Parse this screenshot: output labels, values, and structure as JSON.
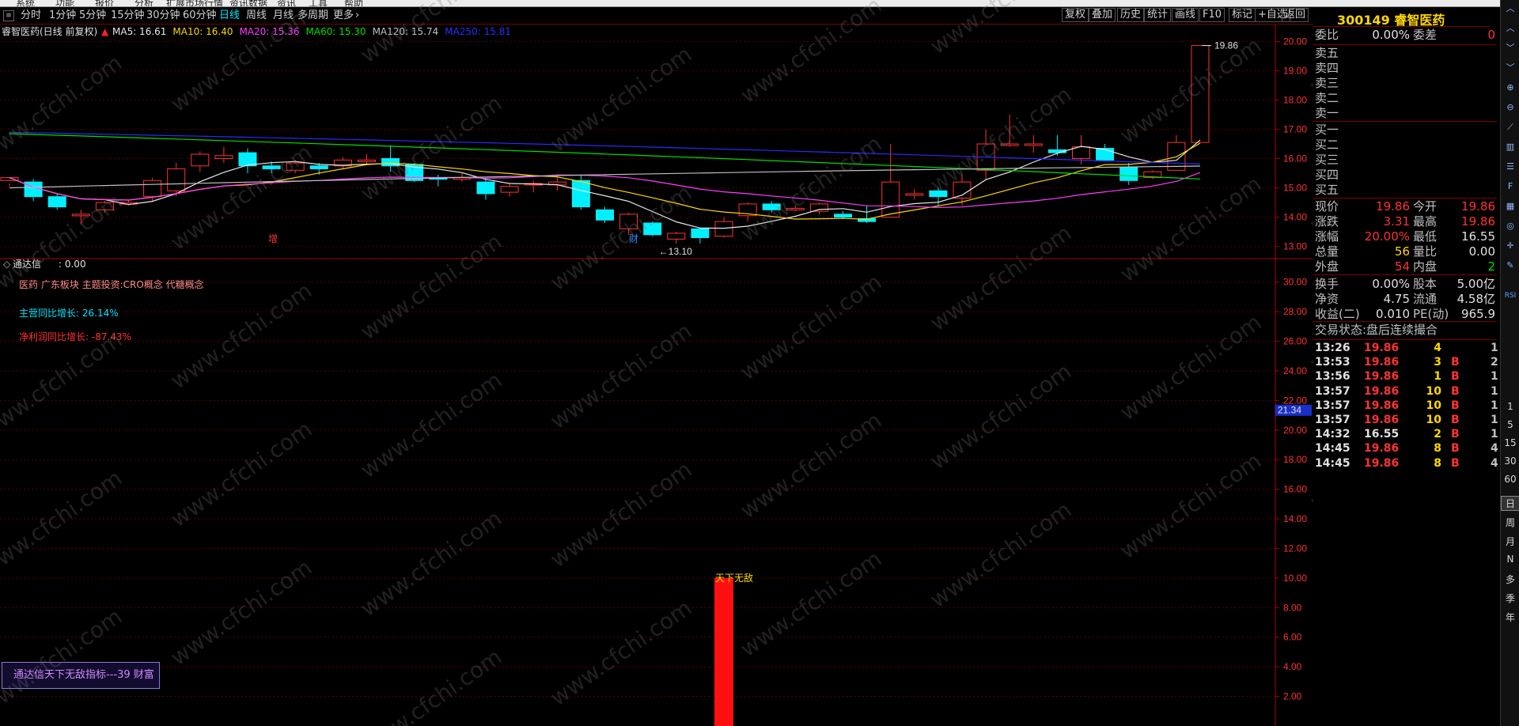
{
  "menubar": {
    "items": [
      "系统",
      "功能",
      "报价",
      "分析",
      "扩展市场行情",
      "资讯数据",
      "资讯",
      "工具",
      "帮助"
    ]
  },
  "period_bar": {
    "tabs": [
      "分时",
      "1分钟",
      "5分钟",
      "15分钟",
      "30分钟",
      "60分钟",
      "日线",
      "周线",
      "月线",
      "多周期",
      "更多"
    ],
    "active": "日线",
    "tools": [
      "复权",
      "叠加",
      "历史",
      "统计",
      "画线",
      "F10",
      "标记",
      "+自选",
      "返回"
    ]
  },
  "stock": {
    "code": "300149",
    "name": "睿智医药",
    "title": "300149 睿智医药"
  },
  "chart_header": {
    "name": "睿智医药(日线 前复权)",
    "ma": [
      {
        "label": "MA5: 16.61",
        "color": "#e8e8e8"
      },
      {
        "label": "MA10: 16.40",
        "color": "#ffd700"
      },
      {
        "label": "MA20: 15.36",
        "color": "#ff3cff"
      },
      {
        "label": "MA60: 15.30",
        "color": "#00e000"
      },
      {
        "label": "MA120: 15.74",
        "color": "#c0c0c0"
      },
      {
        "label": "MA250: 15.81",
        "color": "#2a2aff"
      }
    ]
  },
  "chart_data": [
    {
      "type": "candlestick",
      "title": "睿智医药(日线 前复权)",
      "ylim": [
        12.8,
        20.2
      ],
      "y_ticks": [
        "20.00",
        "19.00",
        "18.00",
        "17.00",
        "16.00",
        "15.00",
        "14.00",
        "13.00"
      ],
      "annotations": {
        "high": "19.86",
        "low": "13.10",
        "marks": [
          "增",
          "财"
        ]
      },
      "candles": [
        [
          15.25,
          15.35,
          15.15,
          15.05
        ],
        [
          15.2,
          14.7,
          15.3,
          14.55
        ],
        [
          14.7,
          14.35,
          14.8,
          14.25
        ],
        [
          14.1,
          14.1,
          14.25,
          13.75
        ],
        [
          14.25,
          14.5,
          14.55,
          14.15
        ],
        [
          14.5,
          14.5,
          14.6,
          14.4
        ],
        [
          14.7,
          15.25,
          15.35,
          14.55
        ],
        [
          14.9,
          15.65,
          15.85,
          14.7
        ],
        [
          15.75,
          16.15,
          16.25,
          15.55
        ],
        [
          16.0,
          16.1,
          16.4,
          15.85
        ],
        [
          16.2,
          15.75,
          16.35,
          15.5
        ],
        [
          15.75,
          15.65,
          15.9,
          15.5
        ],
        [
          15.6,
          15.85,
          15.95,
          15.5
        ],
        [
          15.75,
          15.65,
          15.85,
          15.45
        ],
        [
          15.75,
          15.95,
          16.05,
          15.65
        ],
        [
          15.95,
          15.95,
          16.15,
          15.8
        ],
        [
          16.0,
          15.75,
          16.45,
          15.55
        ],
        [
          15.8,
          15.25,
          15.85,
          15.2
        ],
        [
          15.35,
          15.3,
          15.45,
          15.05
        ],
        [
          15.35,
          15.35,
          15.5,
          15.2
        ],
        [
          15.2,
          14.8,
          15.3,
          14.6
        ],
        [
          14.85,
          15.05,
          15.15,
          14.7
        ],
        [
          15.15,
          15.15,
          15.25,
          14.85
        ],
        [
          15.1,
          15.2,
          15.45,
          14.9
        ],
        [
          15.25,
          14.35,
          15.45,
          14.25
        ],
        [
          14.25,
          13.9,
          14.35,
          13.8
        ],
        [
          13.6,
          14.1,
          14.15,
          13.4
        ],
        [
          13.8,
          13.4,
          13.85,
          13.35
        ],
        [
          13.25,
          13.45,
          13.5,
          13.1
        ],
        [
          13.6,
          13.3,
          13.65,
          13.1
        ],
        [
          13.35,
          13.85,
          14.0,
          13.3
        ],
        [
          14.05,
          14.45,
          14.5,
          13.85
        ],
        [
          14.45,
          14.25,
          14.55,
          14.15
        ],
        [
          14.3,
          14.3,
          14.4,
          14.2
        ],
        [
          14.2,
          14.45,
          14.5,
          14.1
        ],
        [
          14.1,
          14.0,
          14.2,
          13.95
        ],
        [
          13.95,
          13.85,
          14.4,
          13.8
        ],
        [
          14.0,
          15.2,
          16.5,
          14.0
        ],
        [
          14.8,
          14.8,
          14.95,
          14.6
        ],
        [
          14.9,
          14.7,
          15.0,
          14.4
        ],
        [
          14.65,
          15.2,
          15.45,
          14.4
        ],
        [
          15.6,
          16.5,
          17.0,
          15.3
        ],
        [
          16.5,
          16.5,
          17.5,
          16.4
        ],
        [
          16.5,
          16.5,
          16.8,
          16.2
        ],
        [
          16.3,
          16.2,
          16.8,
          16.1
        ],
        [
          16.0,
          16.4,
          16.8,
          15.8
        ],
        [
          16.35,
          15.95,
          16.5,
          15.9
        ],
        [
          15.7,
          15.25,
          15.85,
          15.1
        ],
        [
          15.35,
          15.55,
          15.6,
          15.3
        ],
        [
          15.6,
          16.55,
          16.8,
          15.6
        ],
        [
          16.55,
          19.86,
          19.86,
          16.55
        ]
      ]
    },
    {
      "type": "bar",
      "title": "通达信",
      "ylim": [
        0,
        31
      ],
      "y_ticks": [
        "30.00",
        "28.00",
        "26.00",
        "24.00",
        "22.00",
        "20.00",
        "18.00",
        "16.00",
        "14.00",
        "12.00",
        "10.00",
        "8.00",
        "6.00",
        "4.00",
        "2.00"
      ],
      "current_marker": "21.34",
      "series": [
        {
          "name": "天下无敌",
          "index": 30,
          "value": 10.0,
          "label": "天下无敌"
        }
      ]
    }
  ],
  "indicator": {
    "name": "通达信",
    "value": ": 0.00",
    "concepts": "医药 广东板块 主题投资:CRO概念 代糖概念",
    "revenue_growth": "主营同比增长: 26.14%",
    "profit_growth": "净利润同比增长: -87.43%",
    "legend": "通达信天下无敌指标---39 财富"
  },
  "quote": {
    "weibi_label": "委比",
    "weibi": "0.00%",
    "weicha_label": "委差",
    "weicha": "0",
    "sell": [
      "卖五",
      "卖四",
      "卖三",
      "卖二",
      "卖一"
    ],
    "buy": [
      "买一",
      "买二",
      "买三",
      "买四",
      "买五"
    ],
    "rows": [
      {
        "l1": "现价",
        "v1": "19.86",
        "c1": "red",
        "l2": "今开",
        "v2": "19.86",
        "c2": "red"
      },
      {
        "l1": "涨跌",
        "v1": "3.31",
        "c1": "red",
        "l2": "最高",
        "v2": "19.86",
        "c2": "red"
      },
      {
        "l1": "涨幅",
        "v1": "20.00%",
        "c1": "red",
        "l2": "最低",
        "v2": "16.55",
        "c2": "wht"
      },
      {
        "l1": "总量",
        "v1": "56",
        "c1": "yel",
        "l2": "量比",
        "v2": "0.00",
        "c2": "wht"
      },
      {
        "l1": "外盘",
        "v1": "54",
        "c1": "red",
        "l2": "内盘",
        "v2": "2",
        "c2": "grn"
      },
      {
        "l1": "换手",
        "v1": "0.00%",
        "c1": "wht",
        "l2": "股本",
        "v2": "5.00亿",
        "c2": "wht"
      },
      {
        "l1": "净资",
        "v1": "4.75",
        "c1": "wht",
        "l2": "流通",
        "v2": "4.58亿",
        "c2": "wht"
      },
      {
        "l1": "收益(二)",
        "v1": "0.010",
        "c1": "wht",
        "l2": "PE(动)",
        "v2": "965.9",
        "c2": "wht"
      }
    ],
    "status": "交易状态:盘后连续撮合"
  },
  "trades": [
    {
      "time": "13:26",
      "price": "19.86",
      "vol": "4",
      "side": "",
      "n": "1",
      "vc": "yel"
    },
    {
      "time": "13:53",
      "price": "19.86",
      "vol": "3",
      "side": "B",
      "n": "2",
      "vc": "yel"
    },
    {
      "time": "13:56",
      "price": "19.86",
      "vol": "1",
      "side": "B",
      "n": "1",
      "vc": "yel"
    },
    {
      "time": "13:57",
      "price": "19.86",
      "vol": "10",
      "side": "B",
      "n": "1",
      "vc": "yel"
    },
    {
      "time": "13:57",
      "price": "19.86",
      "vol": "10",
      "side": "B",
      "n": "1",
      "vc": "yel"
    },
    {
      "time": "13:57",
      "price": "19.86",
      "vol": "10",
      "side": "B",
      "n": "1",
      "vc": "yel"
    },
    {
      "time": "14:32",
      "price": "16.55",
      "vol": "2",
      "side": "B",
      "n": "1",
      "vc": "yel",
      "pc": "wht"
    },
    {
      "time": "14:45",
      "price": "19.86",
      "vol": "8",
      "side": "B",
      "n": "4",
      "vc": "yel"
    },
    {
      "time": "14:45",
      "price": "19.86",
      "vol": "8",
      "side": "B",
      "n": "4",
      "vc": "yel"
    }
  ],
  "right_toolbar": {
    "labels": [
      "1",
      "5",
      "15",
      "30",
      "60",
      "日",
      "周",
      "月",
      "N",
      "多",
      "季",
      "年"
    ]
  },
  "watermark": "www.cfchi.com",
  "colors": {
    "up": "#ff3232",
    "down": "#00f0ff",
    "grid": "#5a0000",
    "axis": "#b00000"
  }
}
